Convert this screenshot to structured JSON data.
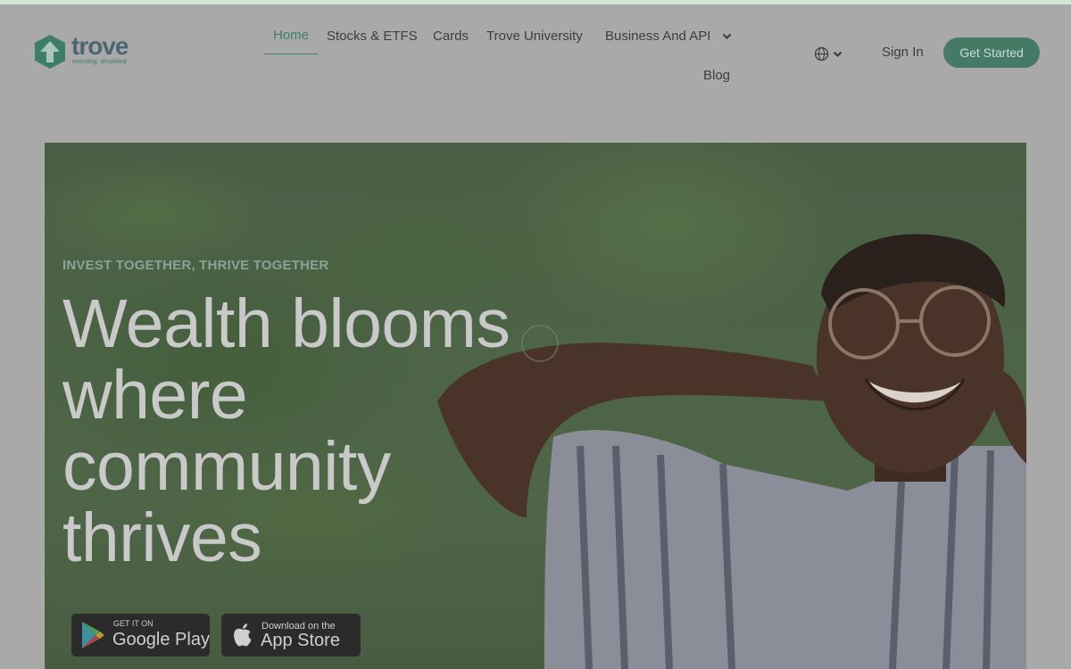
{
  "brand": {
    "name": "trove",
    "tagline": "investing, simplified",
    "colors": {
      "accent": "#447a66",
      "logo_green": "#3f7e66",
      "logo_slate": "#4d6770"
    }
  },
  "nav": {
    "items": [
      {
        "label": "Home",
        "active": true
      },
      {
        "label": "Stocks & ETFS"
      },
      {
        "label": "Cards"
      },
      {
        "label": "Trove University"
      },
      {
        "label": "Business And API",
        "has_dropdown": true
      },
      {
        "label": "Blog"
      }
    ],
    "language_icon": "globe-icon",
    "sign_in": "Sign In",
    "get_started": "Get Started"
  },
  "hero": {
    "eyebrow": "INVEST TOGETHER, THRIVE TOGETHER",
    "headline_lines": [
      "Wealth blooms",
      "where",
      "community",
      "thrives"
    ],
    "image": "smiling man lying on green grass",
    "google_play": {
      "small": "GET IT ON",
      "big": "Google Play",
      "icon": "google-play-icon"
    },
    "app_store": {
      "small": "Download on the",
      "big": "App Store",
      "icon": "apple-icon"
    }
  }
}
